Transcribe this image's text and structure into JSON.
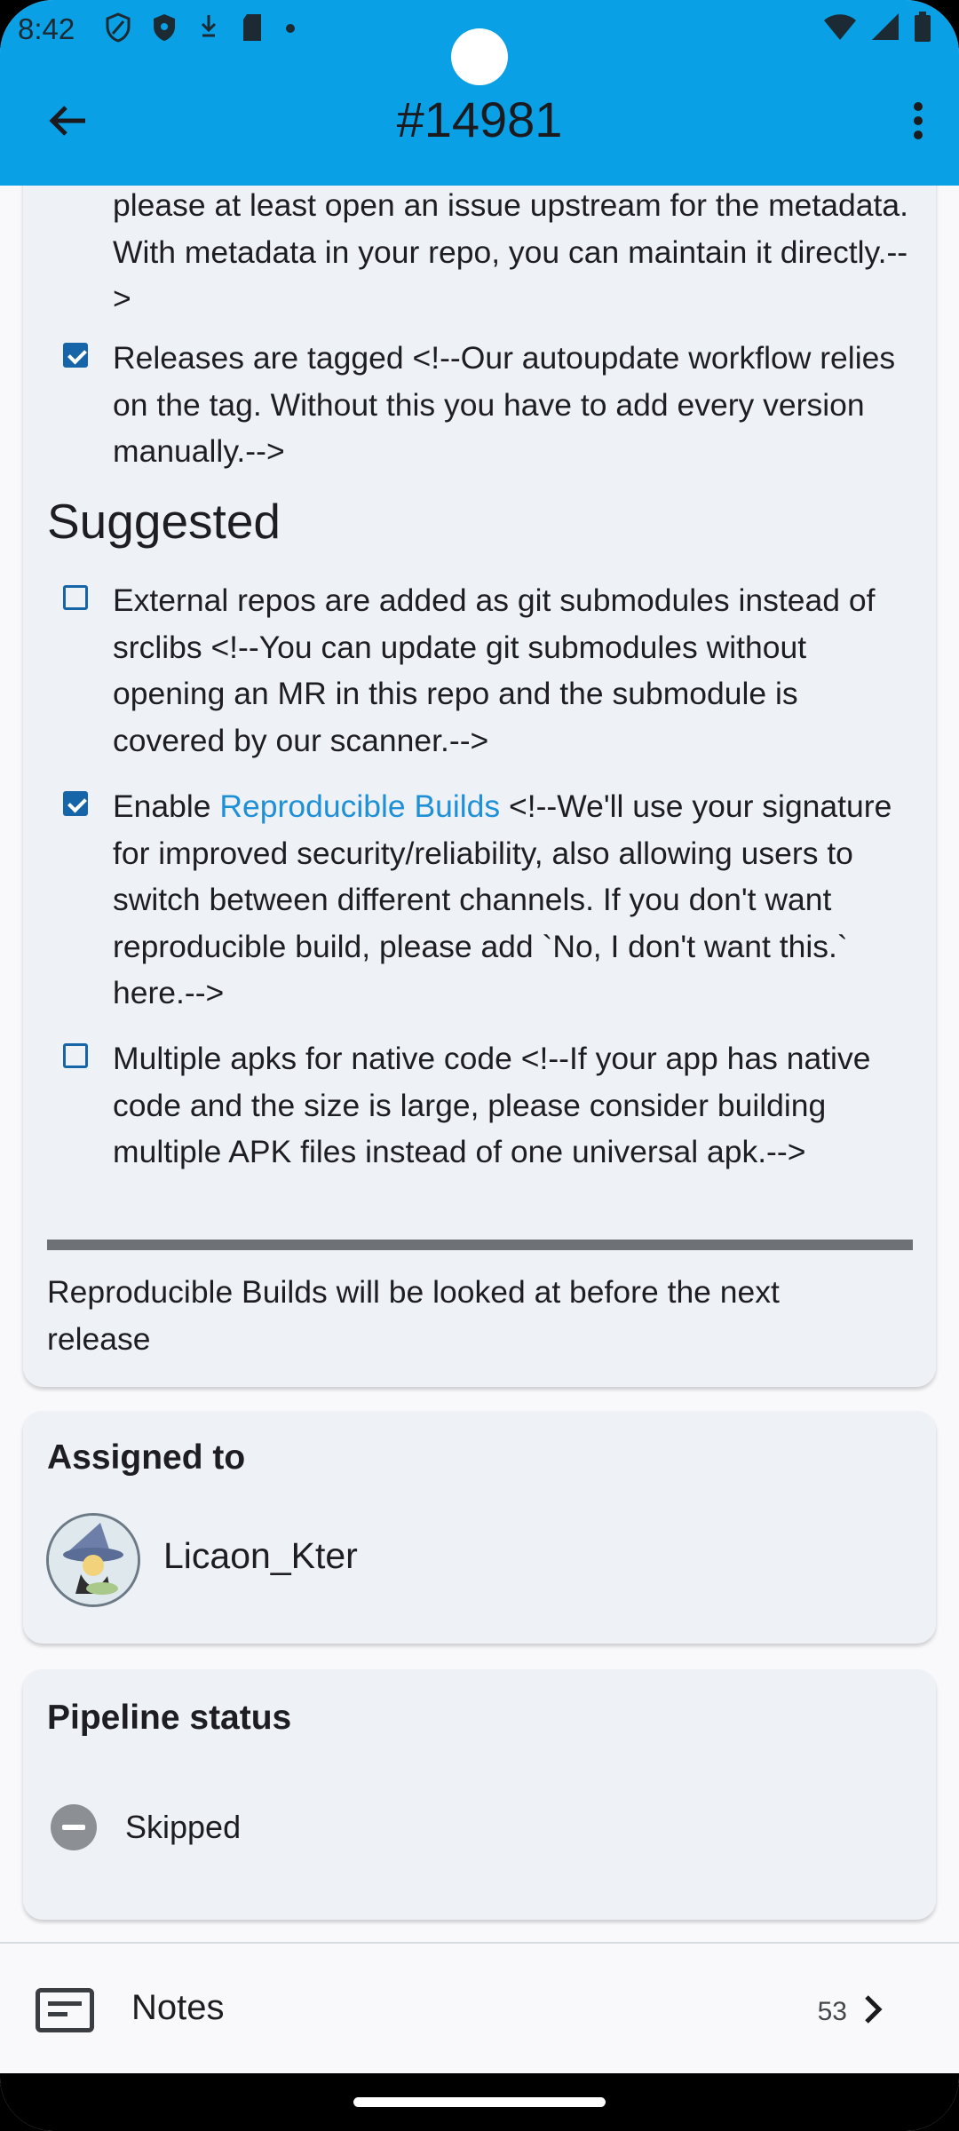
{
  "status_bar": {
    "time": "8:42"
  },
  "app_bar": {
    "title": "#14981"
  },
  "description": {
    "items": [
      {
        "checked": null,
        "text": "please at least open an issue upstream for the metadata. With metadata in your repo, you can maintain it directly.-->"
      },
      {
        "checked": true,
        "text": "Releases are tagged <!--Our autoupdate workflow relies on the tag. Without this you have to add every version manually.-->"
      }
    ],
    "heading": "Suggested",
    "suggested_items": [
      {
        "checked": false,
        "text": "External repos are added as git submodules instead of srclibs <!--You can update git submodules without opening an MR in this repo and the submodule is covered by our scanner.-->"
      },
      {
        "checked": true,
        "prefix": "Enable ",
        "link": "Reproducible Builds",
        "suffix": " <!--We'll use your signature for improved security/reliability, also allowing users to switch between different channels. If you don't want reproducible build, please add `No, I don't want this.` here.-->"
      },
      {
        "checked": false,
        "text": "Multiple apks for native code <!--If your app has native code and the size is large, please consider building multiple APK files instead of one universal apk.-->"
      }
    ],
    "footer_note": "Reproducible Builds will be looked at before the next release"
  },
  "assigned": {
    "title": "Assigned to",
    "user": "Licaon_Kter"
  },
  "pipeline": {
    "title": "Pipeline status",
    "status": "Skipped"
  },
  "notes": {
    "label": "Notes",
    "count": "53"
  },
  "colors": {
    "app_bar": "#0aa0e6",
    "checkbox": "#1565a8",
    "link": "#1e90d8",
    "card": "#eef1f5"
  }
}
